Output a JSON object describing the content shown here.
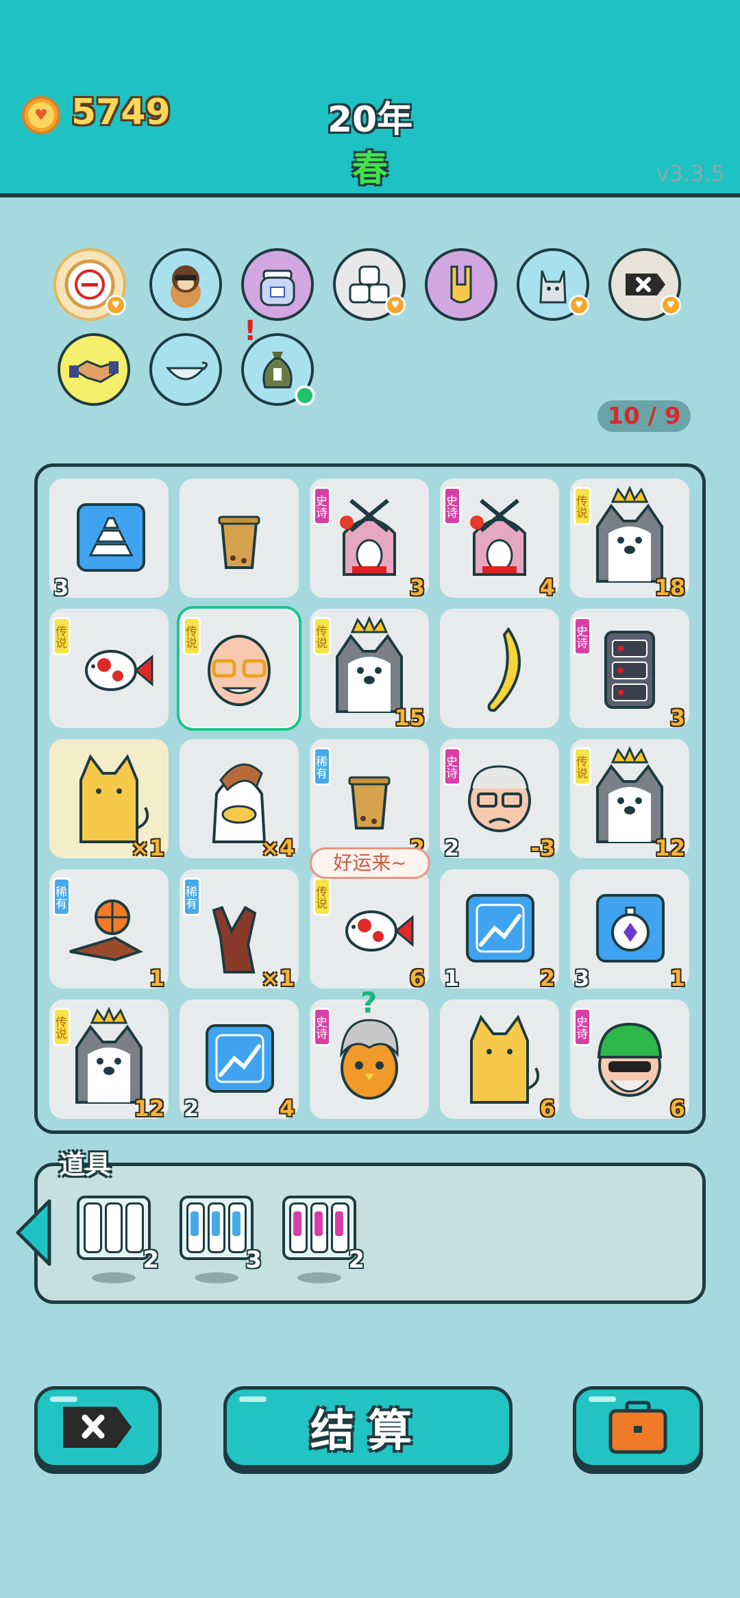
{
  "header": {
    "coins": "5749",
    "coin_icon": "heart-coin-icon",
    "year": "20年",
    "season": "春",
    "version": "v3.3.5"
  },
  "colors": {
    "header_bg": "#1ec2c2",
    "page_bg": "#a5d9de",
    "cell_bg": "#e8ebeb",
    "epic_tag": "#d83fa6",
    "legendary_tag": "#f6e34a",
    "rare_tag": "#47a9e8",
    "selected_outline": "#1fc388",
    "counter_text": "#d62a2a"
  },
  "status_icons": [
    {
      "name": "minus-coin-icon"
    },
    {
      "name": "dog-sunglasses-icon"
    },
    {
      "name": "jar-icon"
    },
    {
      "name": "dice-icon"
    },
    {
      "name": "rock-hand-icon"
    },
    {
      "name": "wolf-icon"
    },
    {
      "name": "remove-tag-icon"
    },
    {
      "name": "handshake-icon"
    },
    {
      "name": "gravy-boat-icon"
    },
    {
      "name": "money-bag-icon"
    }
  ],
  "slot_counter": "10 / 9",
  "board": {
    "cells": [
      {
        "id": "gold-bars",
        "tag": "",
        "num_l": "3",
        "num_r": ""
      },
      {
        "id": "milk-tea",
        "tag": "",
        "num_l": "",
        "num_r": ""
      },
      {
        "id": "rabbit-house",
        "tag": "史诗",
        "num_l": "",
        "num_r": "3"
      },
      {
        "id": "rabbit-house",
        "tag": "史诗",
        "num_l": "",
        "num_r": "4"
      },
      {
        "id": "husky-king",
        "tag": "传说",
        "num_l": "",
        "num_r": "18"
      },
      {
        "id": "koi-fish",
        "tag": "传说",
        "num_l": "",
        "num_r": ""
      },
      {
        "id": "old-man-face",
        "tag": "传说",
        "num_l": "",
        "num_r": ""
      },
      {
        "id": "husky-king",
        "tag": "传说",
        "num_l": "",
        "num_r": "15"
      },
      {
        "id": "banana",
        "tag": "",
        "num_l": "",
        "num_r": ""
      },
      {
        "id": "server-rack",
        "tag": "史诗",
        "num_l": "",
        "num_r": "3"
      },
      {
        "id": "yellow-cat",
        "tag": "",
        "num_l": "",
        "num_r": "×1"
      },
      {
        "id": "cow-mascot",
        "tag": "",
        "num_l": "",
        "num_r": "×4"
      },
      {
        "id": "milk-tea",
        "tag": "稀有",
        "num_l": "",
        "num_r": "2"
      },
      {
        "id": "grumpy-grandpa",
        "tag": "史诗",
        "num_l": "2",
        "num_r": "-3"
      },
      {
        "id": "husky-king",
        "tag": "传说",
        "num_l": "",
        "num_r": "12"
      },
      {
        "id": "basketball-hand",
        "tag": "稀有",
        "num_l": "",
        "num_r": "1"
      },
      {
        "id": "rock-hand",
        "tag": "稀有",
        "num_l": "",
        "num_r": "×1"
      },
      {
        "id": "koi-fish",
        "tag": "传说",
        "num_l": "",
        "num_r": "6"
      },
      {
        "id": "chart-card",
        "tag": "",
        "num_l": "1",
        "num_r": "2"
      },
      {
        "id": "stopwatch-card",
        "tag": "",
        "num_l": "3",
        "num_r": "1"
      },
      {
        "id": "husky-king",
        "tag": "传说",
        "num_l": "",
        "num_r": "12"
      },
      {
        "id": "chart-card",
        "tag": "",
        "num_l": "2",
        "num_r": "4"
      },
      {
        "id": "owl-chick",
        "tag": "史诗",
        "num_l": "",
        "num_r": ""
      },
      {
        "id": "yellow-cat",
        "tag": "",
        "num_l": "",
        "num_r": "6"
      },
      {
        "id": "green-cap-guy",
        "tag": "史诗",
        "num_l": "",
        "num_r": "6"
      }
    ]
  },
  "bubble": "好运来~",
  "question_mark": "?",
  "items": {
    "title": "道具",
    "list": [
      {
        "name": "plain-card-pack",
        "count": "2"
      },
      {
        "name": "rare-card-pack",
        "count": "3"
      },
      {
        "name": "epic-card-pack",
        "count": "2"
      }
    ]
  },
  "buttons": {
    "settle": "结算"
  }
}
